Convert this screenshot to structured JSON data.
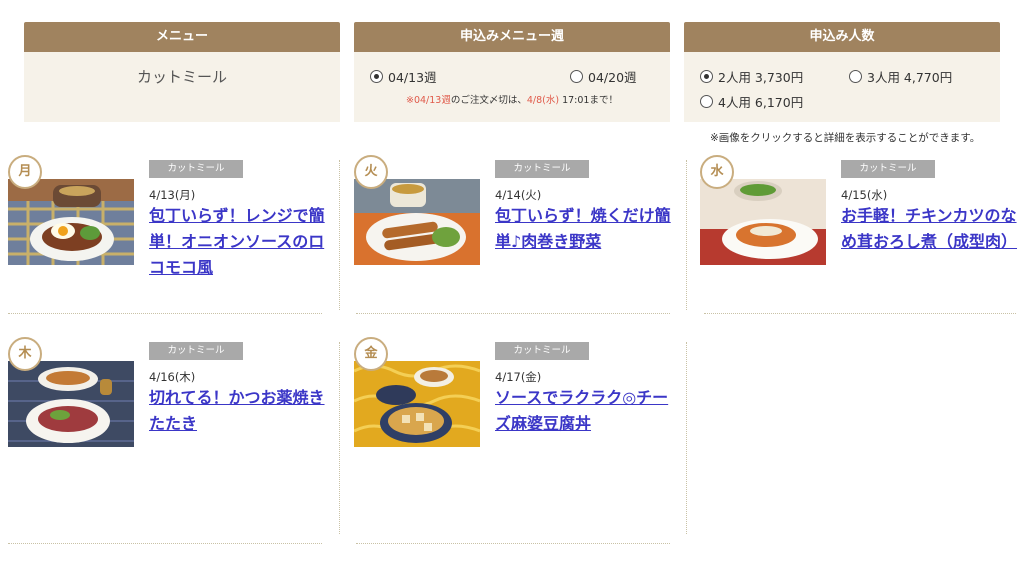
{
  "options": {
    "menu": {
      "header": "メニュー",
      "value": "カットミール"
    },
    "week": {
      "header": "申込みメニュー週",
      "choices": [
        {
          "label": "04/13週",
          "selected": true
        },
        {
          "label": "04/20週",
          "selected": false
        }
      ],
      "deadline_prefix": "※",
      "deadline_week": "04/13週",
      "deadline_mid": "のご注文〆切は、",
      "deadline_date": "4/8(水)",
      "deadline_suffix": " 17:01まで！"
    },
    "servings": {
      "header": "申込み人数",
      "choices": [
        {
          "label": "2人用 3,730円",
          "selected": true
        },
        {
          "label": "3人用 4,770円",
          "selected": false
        },
        {
          "label": "4人用 6,170円",
          "selected": false
        }
      ]
    }
  },
  "hint": "※画像をクリックすると詳細を表示することができます。",
  "tag_label": "カットミール",
  "days": [
    {
      "badge": "月",
      "date": "4/13(月)",
      "title": "包丁いらず！レンジで簡単！オニオンソースのロコモコ風"
    },
    {
      "badge": "火",
      "date": "4/14(火)",
      "title": "包丁いらず！焼くだけ簡単♪肉巻き野菜"
    },
    {
      "badge": "水",
      "date": "4/15(水)",
      "title": "お手軽！チキンカツのなめ茸おろし煮（成型肉）"
    },
    {
      "badge": "木",
      "date": "4/16(木)",
      "title": "切れてる！かつお薬焼きたたき"
    },
    {
      "badge": "金",
      "date": "4/17(金)",
      "title": "ソースでラクラク◎チーズ麻婆豆腐丼"
    }
  ],
  "colors": {
    "header_bg": "#a0835f",
    "panel_bg": "#f6f2e9",
    "link": "#3b36c7",
    "badge": "#b48d52",
    "deadline_red": "#e05a4a"
  }
}
